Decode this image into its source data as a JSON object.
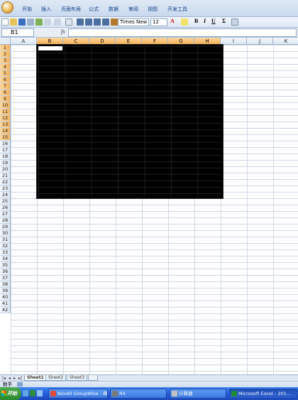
{
  "ribbon": {
    "tabs": [
      "开始",
      "插入",
      "页面布局",
      "公式",
      "数据",
      "审阅",
      "视图",
      "开发工具"
    ]
  },
  "toolbar": {
    "font_name": "Times New F",
    "font_size": "12",
    "bold": "B",
    "italic": "I",
    "underline": "U",
    "sum": "Σ"
  },
  "formula_bar": {
    "name_box": "B1",
    "fx": "fx",
    "value": ""
  },
  "grid": {
    "columns": [
      "A",
      "B",
      "C",
      "D",
      "E",
      "F",
      "G",
      "H",
      "I",
      "J",
      "K"
    ],
    "selected_columns": [
      "B",
      "C",
      "D",
      "E",
      "F",
      "G",
      "H"
    ],
    "rows": [
      "1",
      "2",
      "3",
      "4",
      "5",
      "6",
      "7",
      "8",
      "9",
      "10",
      "11",
      "12",
      "13",
      "14",
      "15",
      "16",
      "17",
      "18",
      "19",
      "20",
      "21",
      "22",
      "23",
      "24",
      "25",
      "26",
      "27",
      "28",
      "29",
      "30",
      "31",
      "32",
      "33",
      "34",
      "35",
      "36",
      "37",
      "38",
      "39",
      "40",
      "41",
      "42"
    ],
    "selected_rows_to": 15,
    "fill_range": "B1:H15",
    "fill_color": "#000000",
    "active_cell": "B1"
  },
  "sheets": {
    "tabs": [
      "Sheet1",
      "Sheet2",
      "Sheet3"
    ],
    "active": "Sheet1"
  },
  "status": {
    "mode": "数字"
  },
  "taskbar": {
    "start": "开始",
    "items": [
      {
        "label": "Novell GroupWise - 邮箱",
        "color": "#e04a3c"
      },
      {
        "label": "R4",
        "color": "#7a7a7a"
      },
      {
        "label": "计算器",
        "color": "#c0c0c0"
      },
      {
        "label": "Microsoft Excel - 201...",
        "color": "#1f8a3a"
      }
    ]
  }
}
